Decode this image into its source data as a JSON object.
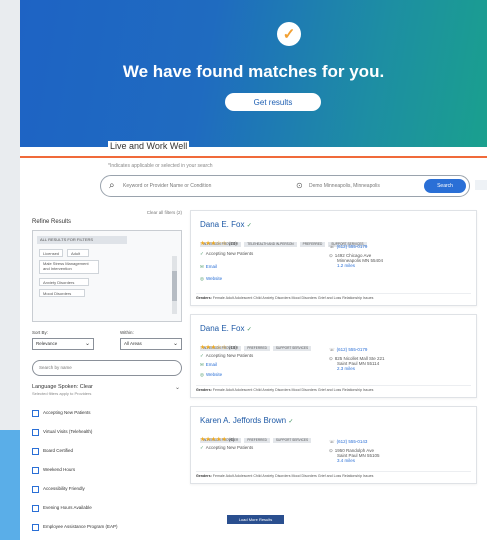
{
  "hero": {
    "headline": "We have found matches for you.",
    "results_button": "Get results"
  },
  "work_type": {
    "title": "Live and Work Well",
    "helper": "*Indicates applicable or selected in your search"
  },
  "search": {
    "query": "Keyword or Provider Name or Condition",
    "location": "Demo Minneapolis, Minneapolis",
    "button": "Search"
  },
  "filters": {
    "title": "Refine Results",
    "clear": "Clear all filters (2)",
    "box_header": "ALL RESULTS FOR FILTERS",
    "chips": [
      "Licensed",
      "Adult",
      "Male Stress Management and Intervention",
      "Anxiety Disorders",
      "Mood Disorders"
    ],
    "sort_label": "Sort By:",
    "within_label": "Within:",
    "sort_value": "Relevance",
    "within_value": "All Areas",
    "name_filter": "Search by name",
    "language_title": "Language Spoken: Clear",
    "language_sub": "Selected filters apply to Providers",
    "checkboxes": [
      "Accepting New Patients",
      "Virtual Visits (Telehealth)",
      "Board Certified",
      "Weekend Hours",
      "Accessibility Friendly",
      "Evening Hours Available",
      "Employee Assistance Program (EAP)"
    ]
  },
  "cards": [
    {
      "name": "Dana E. Fox",
      "tags": [
        "IN-PERSON PROVIDER",
        "TELEHEALTH AND IN-PERSON",
        "PREFERRED",
        "SUPPORT SERVICES"
      ],
      "stars": "★★★☆☆",
      "rating_count": "(20)",
      "accepting": "Accepting New Patients",
      "email": "Email",
      "website": "Website",
      "phone": "(612) 555-0179",
      "address_1": "1492 Chicago Ave",
      "address_2": "Minneapolis MN 55404",
      "distance": "1.2 miles",
      "footer_label": "Genders:",
      "footer_text": "Female   Adult   Adolescent   Child   Anxiety Disorders   Mood Disorders   Grief and Loss   Relationship Issues"
    },
    {
      "name": "Dana E. Fox",
      "tags": [
        "IN-PERSON PROVIDER",
        "PREFERRED",
        "SUPPORT SERVICES"
      ],
      "stars": "★★★☆☆",
      "rating_count": "(15)",
      "accepting": "Accepting New Patients",
      "email": "Email",
      "website": "Website",
      "phone": "(612) 555-0179",
      "address_1": "825 Nicollet Mall Ste 221",
      "address_2": "Saint Paul MN 55114",
      "distance": "2.3 miles",
      "footer_label": "Genders:",
      "footer_text": "Female   Adult   Adolescent   Child   Anxiety Disorders   Mood Disorders   Grief and Loss   Relationship Issues"
    },
    {
      "name": "Karen A. Jeffords Brown",
      "tags": [
        "IN-PERSON PROVIDER",
        "PREFERRED",
        "SUPPORT SERVICES"
      ],
      "stars": "★★★★★",
      "rating_count": "(6)",
      "accepting": "Accepting New Patients",
      "email": "",
      "website": "",
      "phone": "(612) 555-0143",
      "address_1": "1950 Randolph Ave",
      "address_2": "Saint Paul MN 55105",
      "distance": "3.4 miles",
      "footer_label": "Genders:",
      "footer_text": "Female   Adult   Adolescent   Child   Anxiety Disorders   Mood Disorders   Grief and Loss   Relationship Issues"
    }
  ],
  "more_button": "Load More Results"
}
